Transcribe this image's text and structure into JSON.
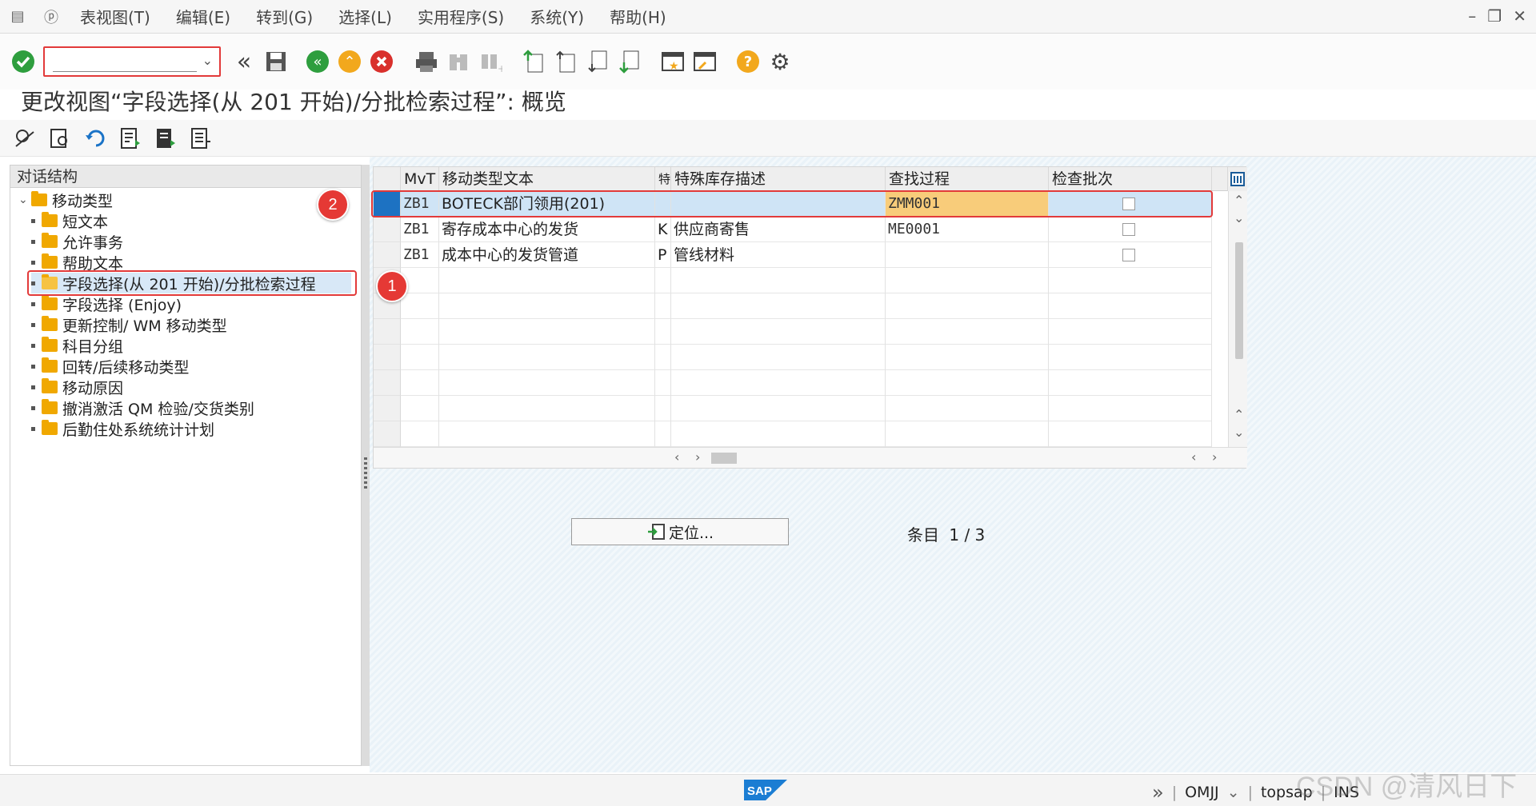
{
  "menubar": {
    "items": [
      "表视图(T)",
      "编辑(E)",
      "转到(G)",
      "选择(L)",
      "实用程序(S)",
      "系统(Y)",
      "帮助(H)"
    ]
  },
  "toolbar": {
    "command_value": ""
  },
  "page_title": "更改视图“字段选择(从 201 开始)/分批检索过程”: 概览",
  "dialog": {
    "title": "对话结构",
    "root": "移动类型",
    "items": [
      "短文本",
      "允许事务",
      "帮助文本",
      "字段选择(从 201 开始)/分批检索过程",
      "字段选择 (Enjoy)",
      "更新控制/ WM 移动类型",
      "科目分组",
      "回转/后续移动类型",
      "移动原因",
      "撤消激活 QM 检验/交货类别",
      "后勤住处系统统计计划"
    ]
  },
  "table": {
    "columns": [
      "MvT",
      "移动类型文本",
      "特",
      "特殊库存描述",
      "查找过程",
      "检查批次"
    ],
    "rows": [
      {
        "mvt": "ZB1",
        "text": "BOTECK部门领用(201)",
        "s": "",
        "special": "",
        "proc": "ZMM001",
        "check": false
      },
      {
        "mvt": "ZB1",
        "text": "寄存成本中心的发货",
        "s": "K",
        "special": "供应商寄售",
        "proc": "ME0001",
        "check": false
      },
      {
        "mvt": "ZB1",
        "text": "成本中心的发货管道",
        "s": "P",
        "special": "管线材料",
        "proc": "",
        "check": false
      }
    ]
  },
  "position_button": "定位...",
  "entry_label": "条目",
  "entry_value": "1 / 3",
  "annotations": [
    "1",
    "2"
  ],
  "status": {
    "transaction": "OMJJ",
    "server": "topsap",
    "mode": "INS"
  },
  "watermark": "CSDN @清风日下",
  "colors": {
    "selected_row": "#cfe4f6",
    "highlight_cell": "#f8cc7a",
    "annotation_red": "#e53935",
    "folder": "#f0a800"
  }
}
